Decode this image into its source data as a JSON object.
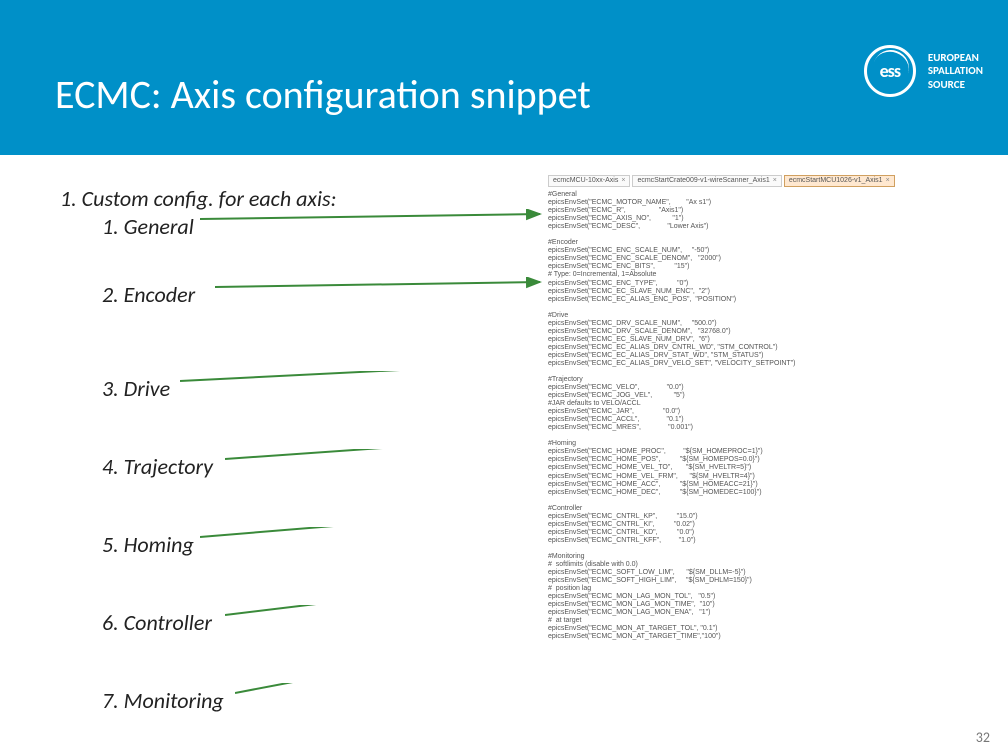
{
  "header": {
    "title": "ECMC: Axis configuration snippet",
    "logo_abbrev": "ess",
    "logo_line1": "EUROPEAN",
    "logo_line2": "SPALLATION",
    "logo_line3": "SOURCE"
  },
  "list": {
    "main": "1.  Custom config. for each axis:",
    "items": [
      "1.  General",
      "2.  Encoder",
      "3.  Drive",
      "4.  Trajectory",
      "5.  Homing",
      "6.  Controller",
      "7.  Monitoring"
    ]
  },
  "tabs": [
    "ecmcMCU-10xx-Axis",
    "ecmcStartCrate009-v1-wireScanner_Axis1",
    "ecmcStartMCU1026-v1_Axis1"
  ],
  "code": {
    "general": "#General\nepicsEnvSet(\"ECMC_MOTOR_NAME\",        \"Ax s1\")\nepicsEnvSet(\"ECMC_R\",                 \"Axis1\")\nepicsEnvSet(\"ECMC_AXIS_NO\",           \"1\")\nepicsEnvSet(\"ECMC_DESC\",              \"Lower Axis\")",
    "encoder": "#Encoder\nepicsEnvSet(\"ECMC_ENC_SCALE_NUM\",     \"-50\")\nepicsEnvSet(\"ECMC_ENC_SCALE_DENOM\",   \"2000\")\nepicsEnvSet(\"ECMC_ENC_BITS\",          \"15\")\n# Type: 0=Incremental, 1=Absolute\nepicsEnvSet(\"ECMC_ENC_TYPE\",          \"0\")\nepicsEnvSet(\"ECMC_EC_SLAVE_NUM_ENC\",  \"2\")\nepicsEnvSet(\"ECMC_EC_ALIAS_ENC_POS\",  \"POSITION\")",
    "drive": "#Drive\nepicsEnvSet(\"ECMC_DRV_SCALE_NUM\",     \"500.0\")\nepicsEnvSet(\"ECMC_DRV_SCALE_DENOM\",   \"32768.0\")\nepicsEnvSet(\"ECMC_EC_SLAVE_NUM_DRV\",  \"6\")\nepicsEnvSet(\"ECMC_EC_ALIAS_DRV_CNTRL_WD\", \"STM_CONTROL\")\nepicsEnvSet(\"ECMC_EC_ALIAS_DRV_STAT_WD\", \"STM_STATUS\")\nepicsEnvSet(\"ECMC_EC_ALIAS_DRV_VELO_SET\", \"VELOCITY_SETPOINT\")",
    "trajectory": "#Trajectory\nepicsEnvSet(\"ECMC_VELO\",              \"0.0\")\nepicsEnvSet(\"ECMC_JOG_VEL\",           \"5\")\n#JAR defaults to VELO/ACCL\nepicsEnvSet(\"ECMC_JAR\",               \"0.0\")\nepicsEnvSet(\"ECMC_ACCL\",              \"0.1\")\nepicsEnvSet(\"ECMC_MRES\",              \"0.001\")",
    "homing": "#Homing\nepicsEnvSet(\"ECMC_HOME_PROC\",         \"${SM_HOMEPROC=1}\")\nepicsEnvSet(\"ECMC_HOME_POS\",          \"${SM_HOMEPOS=0.0}\")\nepicsEnvSet(\"ECMC_HOME_VEL_TO\",       \"${SM_HVELTR=5}\")\nepicsEnvSet(\"ECMC_HOME_VEL_FRM\",      \"${SM_HVELTR=4}\")\nepicsEnvSet(\"ECMC_HOME_ACC\",          \"${SM_HOMEACC=21}\")\nepicsEnvSet(\"ECMC_HOME_DEC\",          \"${SM_HOMEDEC=100}\")",
    "controller": "#Controller\nepicsEnvSet(\"ECMC_CNTRL_KP\",          \"15.0\")\nepicsEnvSet(\"ECMC_CNTRL_KI\",          \"0.02\")\nepicsEnvSet(\"ECMC_CNTRL_KD\",          \"0.0\")\nepicsEnvSet(\"ECMC_CNTRL_KFF\",         \"1.0\")",
    "monitoring": "#Monitoring\n#  softlimits (disable with 0.0)\nepicsEnvSet(\"ECMC_SOFT_LOW_LIM\",      \"${SM_DLLM=-5}\")\nepicsEnvSet(\"ECMC_SOFT_HIGH_LIM\",     \"${SM_DHLM=150}\")\n#  position lag\nepicsEnvSet(\"ECMC_MON_LAG_MON_TOL\",   \"0.5\")\nepicsEnvSet(\"ECMC_MON_LAG_MON_TIME\",  \"10\")\nepicsEnvSet(\"ECMC_MON_LAG_MON_ENA\",   \"1\")\n#  at target\nepicsEnvSet(\"ECMC_MON_AT_TARGET_TOL\", \"0.1\")\nepicsEnvSet(\"ECMC_MON_AT_TARGET_TIME\",\"100\")"
  },
  "page_number": "32",
  "arrow_color": "#3a8a3a"
}
